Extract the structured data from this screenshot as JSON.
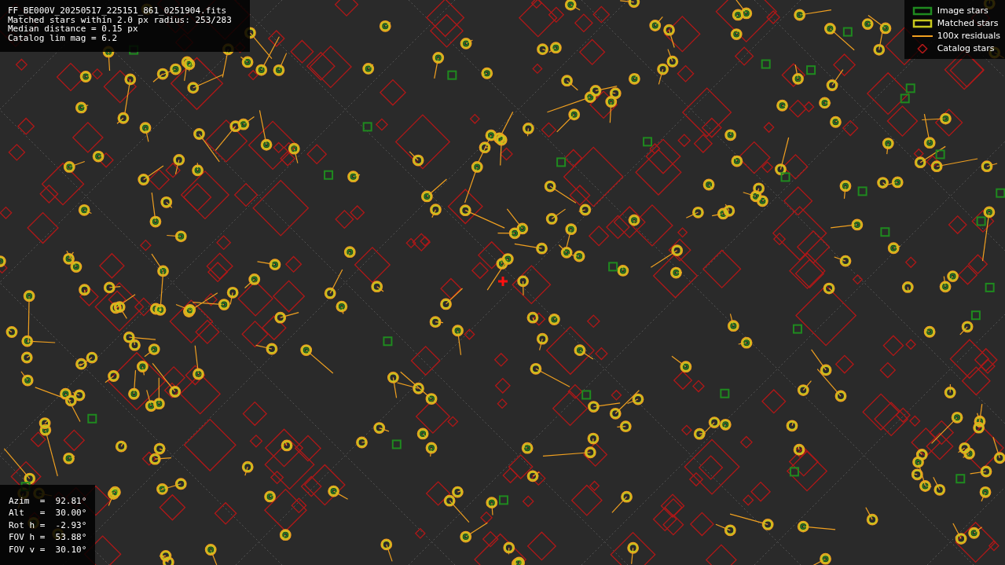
{
  "info": {
    "lines": [
      "FF_BE000V_20250517_225151_861_0251904.fits",
      "Matched stars within 2.0 px radius: 253/283",
      "Median distance = 0.15 px",
      "Catalog lim mag = 6.2"
    ]
  },
  "legend": [
    {
      "kind": "image",
      "label": "Image stars",
      "color": "#1f8a1f"
    },
    {
      "kind": "matched",
      "label": "Matched stars",
      "color": "#c8c81e"
    },
    {
      "kind": "residual",
      "label": "100x residuals",
      "color": "#f0a020"
    },
    {
      "kind": "catalog",
      "label": "Catalog stars",
      "color": "#b01818"
    }
  ],
  "pointing": {
    "lines": [
      "Azim  =  92.81°",
      "Alt   =  30.00°",
      "Rot h =  -2.93°",
      "FOV h =  53.88°",
      "FOV v =  30.10°"
    ]
  }
}
